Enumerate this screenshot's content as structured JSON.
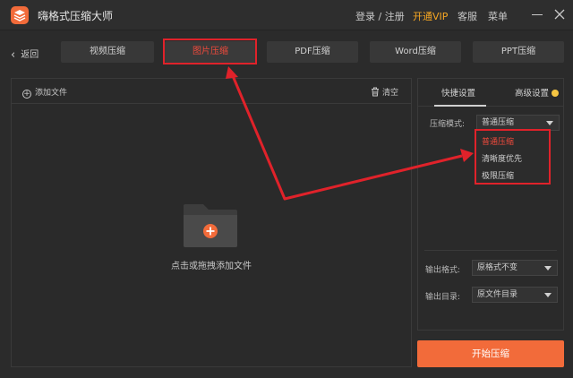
{
  "app": {
    "title": "嗨格式压缩大师"
  },
  "header": {
    "login": "登录 / 注册",
    "vip": "开通VIP",
    "service": "客服",
    "menu": "菜单"
  },
  "nav": {
    "back": "返回",
    "tabs": [
      {
        "label": "视频压缩",
        "active": false
      },
      {
        "label": "图片压缩",
        "active": true
      },
      {
        "label": "PDF压缩",
        "active": false
      },
      {
        "label": "Word压缩",
        "active": false
      },
      {
        "label": "PPT压缩",
        "active": false
      }
    ]
  },
  "files": {
    "add": "添加文件",
    "clear": "清空",
    "drop_hint": "点击或拖拽添加文件"
  },
  "settings": {
    "tabs": {
      "quick": "快捷设置",
      "advanced": "高级设置"
    },
    "mode_label": "压缩模式:",
    "mode_value": "普通压缩",
    "mode_options": [
      "普通压缩",
      "清晰度优先",
      "极限压缩"
    ],
    "format_label": "输出格式:",
    "format_value": "原格式不变",
    "dir_label": "输出目录:",
    "dir_value": "原文件目录"
  },
  "actions": {
    "start": "开始压缩"
  },
  "colors": {
    "accent": "#f26b3a",
    "highlight": "#e0222a",
    "selected": "#f04a3c"
  }
}
